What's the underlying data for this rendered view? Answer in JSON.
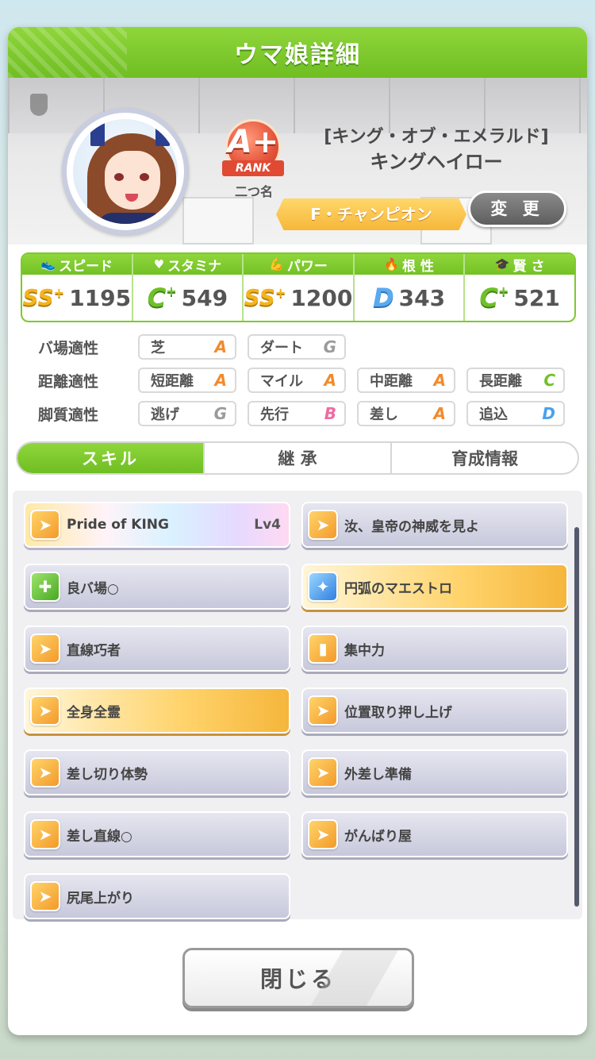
{
  "header": {
    "title": "ウマ娘詳細"
  },
  "profile": {
    "rank_letter": "A+",
    "rank_label": "RANK",
    "nickname_label": "二つ名",
    "epithet": "[キング・オブ・エメラルド]",
    "name": "キングヘイロー",
    "title_plate": "F・チャンピオン",
    "change_label": "変 更"
  },
  "stats": [
    {
      "name": "スピード",
      "icon": "shoe-icon",
      "grade": "SS",
      "grade_plus": "+",
      "value": "1195"
    },
    {
      "name": "スタミナ",
      "icon": "heart-icon",
      "grade": "C",
      "grade_plus": "+",
      "value": "549"
    },
    {
      "name": "パワー",
      "icon": "muscle-icon",
      "grade": "SS",
      "grade_plus": "+",
      "value": "1200"
    },
    {
      "name": "根 性",
      "icon": "flame-icon",
      "grade": "D",
      "grade_plus": "",
      "value": "343"
    },
    {
      "name": "賢 さ",
      "icon": "graduation-cap-icon",
      "grade": "C",
      "grade_plus": "+",
      "value": "521"
    }
  ],
  "aptitude": {
    "track": {
      "label": "バ場適性",
      "items": [
        {
          "name": "芝",
          "grade": "A"
        },
        {
          "name": "ダート",
          "grade": "G"
        }
      ]
    },
    "distance": {
      "label": "距離適性",
      "items": [
        {
          "name": "短距離",
          "grade": "A"
        },
        {
          "name": "マイル",
          "grade": "A"
        },
        {
          "name": "中距離",
          "grade": "A"
        },
        {
          "name": "長距離",
          "grade": "C"
        }
      ]
    },
    "strategy": {
      "label": "脚質適性",
      "items": [
        {
          "name": "逃げ",
          "grade": "G"
        },
        {
          "name": "先行",
          "grade": "B"
        },
        {
          "name": "差し",
          "grade": "A"
        },
        {
          "name": "追込",
          "grade": "D"
        }
      ]
    }
  },
  "tabs": [
    {
      "label": "スキル",
      "active": true
    },
    {
      "label": "継 承",
      "active": false
    },
    {
      "label": "育成情報",
      "active": false
    }
  ],
  "skills": [
    {
      "name": "Pride of KING",
      "level": "Lv4",
      "style": "rainbow",
      "icon": "speed-up-icon"
    },
    {
      "name": "汝、皇帝の神威を見よ",
      "level": "",
      "style": "normal",
      "icon": "speed-up-icon"
    },
    {
      "name": "良バ場○",
      "level": "",
      "style": "normal",
      "icon": "power-up-icon"
    },
    {
      "name": "円弧のマエストロ",
      "level": "",
      "style": "gold",
      "icon": "recovery-icon"
    },
    {
      "name": "直線巧者",
      "level": "",
      "style": "normal",
      "icon": "speed-up-icon"
    },
    {
      "name": "集中力",
      "level": "",
      "style": "normal",
      "icon": "gate-icon"
    },
    {
      "name": "全身全霊",
      "level": "",
      "style": "gold",
      "icon": "speed-up-icon"
    },
    {
      "name": "位置取り押し上げ",
      "level": "",
      "style": "normal",
      "icon": "speed-up-icon"
    },
    {
      "name": "差し切り体勢",
      "level": "",
      "style": "normal",
      "icon": "speed-up-icon"
    },
    {
      "name": "外差し準備",
      "level": "",
      "style": "normal",
      "icon": "speed-up-icon"
    },
    {
      "name": "差し直線○",
      "level": "",
      "style": "normal",
      "icon": "speed-up-icon"
    },
    {
      "name": "がんばり屋",
      "level": "",
      "style": "normal",
      "icon": "speed-up-icon"
    },
    {
      "name": "尻尾上がり",
      "level": "",
      "style": "normal",
      "icon": "speed-up-icon"
    }
  ],
  "footer": {
    "close_label": "閉じる"
  }
}
